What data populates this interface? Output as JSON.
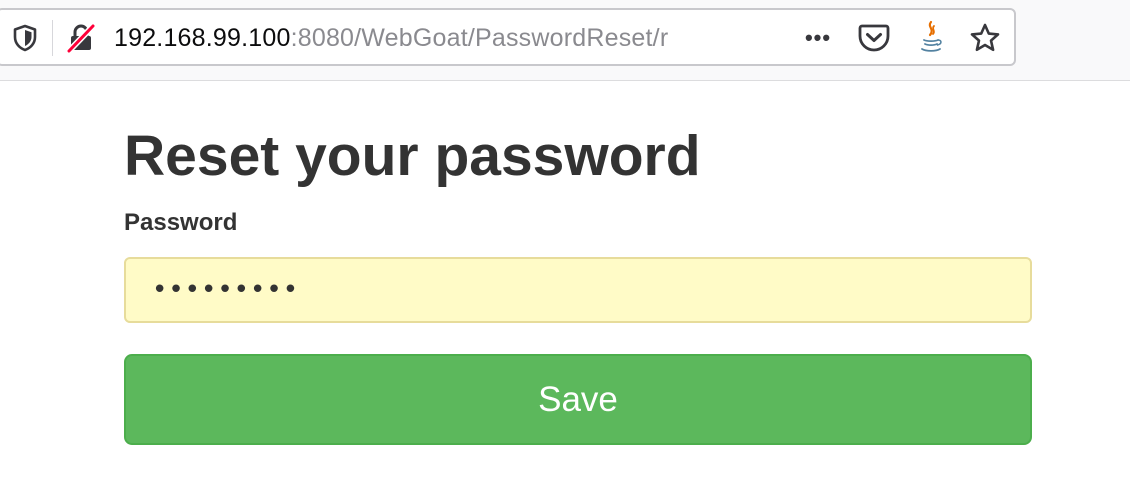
{
  "browser": {
    "url_host": "192.168.99.100",
    "url_rest": ":8080/WebGoat/PasswordReset/r",
    "icons": {
      "tracking_protection": "shield-icon",
      "connection": "insecure-lock-icon",
      "page_actions": "more-icon",
      "save_to_pocket": "pocket-icon",
      "extension": "java-icon",
      "bookmark": "star-icon"
    },
    "page_actions_label": "•••"
  },
  "page": {
    "title": "Reset your password",
    "password_label": "Password",
    "password_value": "•••••••••",
    "save_label": "Save"
  },
  "colors": {
    "primary_text": "#333333",
    "input_autofill_bg": "#fffbc7",
    "save_button": "#5cb85c",
    "insecure_slash": "#ff0039"
  }
}
